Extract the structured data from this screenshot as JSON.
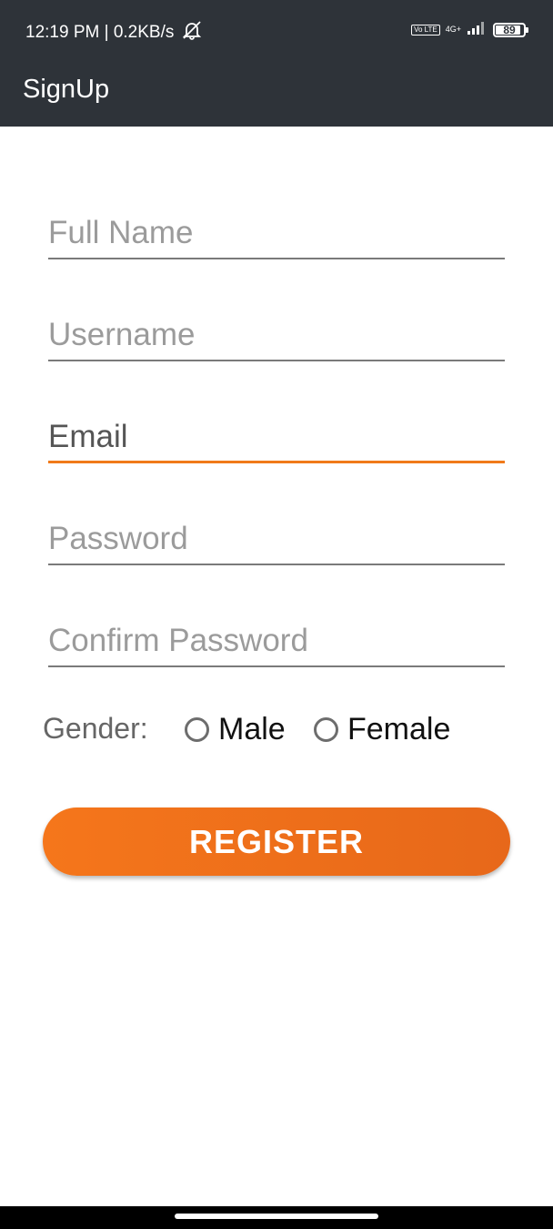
{
  "status_bar": {
    "time_speed": "12:19 PM | 0.2KB/s",
    "volte": "Vo LTE",
    "network": "4G+",
    "battery": "89"
  },
  "app_bar": {
    "title": "SignUp"
  },
  "form": {
    "full_name": {
      "placeholder": "Full Name",
      "value": ""
    },
    "username": {
      "placeholder": "Username",
      "value": ""
    },
    "email": {
      "placeholder": "Email",
      "value": ""
    },
    "password": {
      "placeholder": "Password",
      "value": ""
    },
    "confirm_password": {
      "placeholder": "Confirm Password",
      "value": ""
    },
    "gender": {
      "label": "Gender:",
      "options": [
        "Male",
        "Female"
      ]
    },
    "register_label": "REGISTER"
  },
  "colors": {
    "app_bar": "#2e3339",
    "accent": "#f07a1a",
    "underline": "#7a7a7a"
  }
}
